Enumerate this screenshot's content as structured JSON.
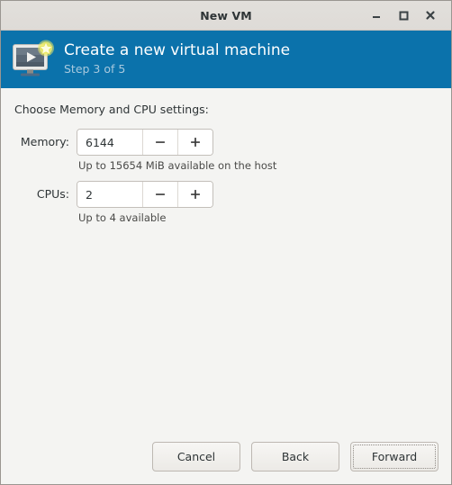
{
  "window": {
    "title": "New VM",
    "controls": {
      "minimize_label": "Minimize",
      "maximize_label": "Maximize",
      "close_label": "Close"
    }
  },
  "banner": {
    "title": "Create a new virtual machine",
    "step": "Step 3 of 5",
    "icon": "virtual-machine-monitor-icon",
    "background_color": "#0b72ab",
    "title_color": "#ffffff",
    "step_color": "#a8c9de"
  },
  "content": {
    "intro": "Choose Memory and CPU settings:",
    "fields": [
      {
        "label": "Memory:",
        "name": "memory",
        "value": "6144",
        "decrement_label": "−",
        "increment_label": "+",
        "hint": "Up to 15654 MiB available on the host"
      },
      {
        "label": "CPUs:",
        "name": "cpus",
        "value": "2",
        "decrement_label": "−",
        "increment_label": "+",
        "hint": "Up to 4 available"
      }
    ]
  },
  "footer": {
    "cancel_label": "Cancel",
    "back_label": "Back",
    "forward_label": "Forward",
    "focused_button": "forward"
  }
}
